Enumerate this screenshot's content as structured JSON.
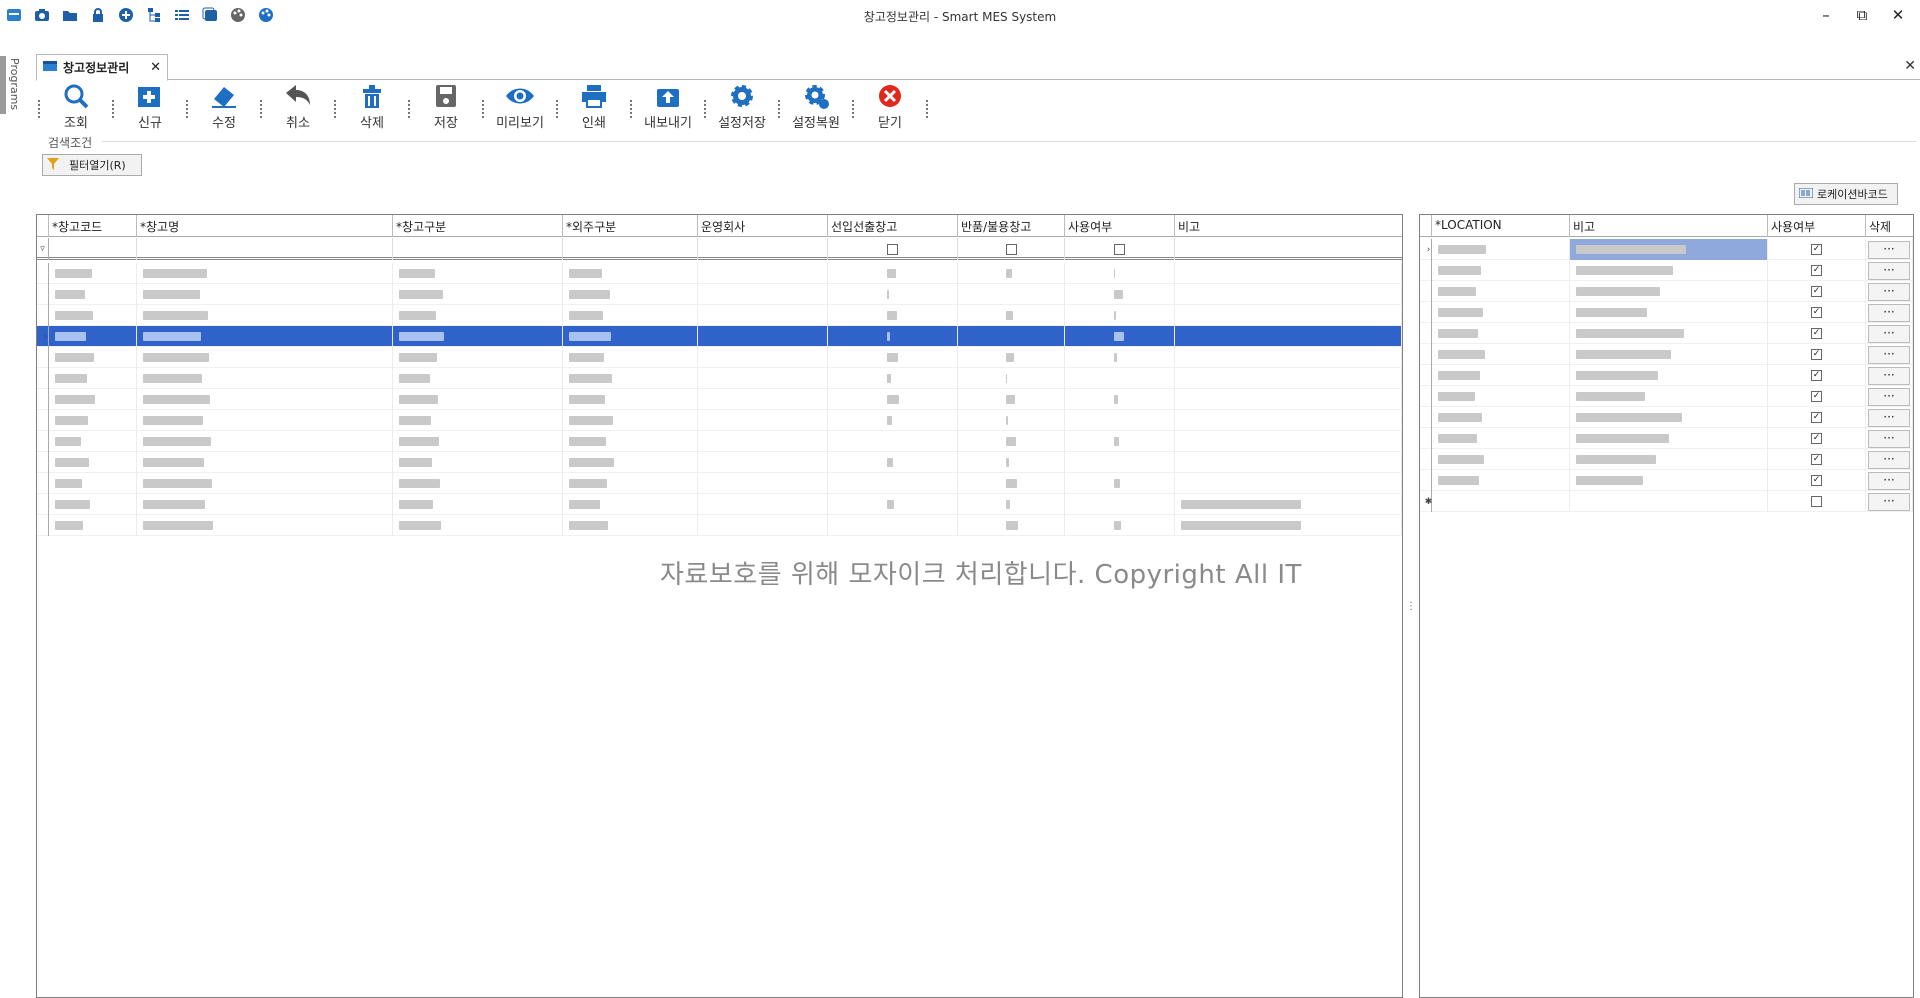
{
  "window": {
    "title": "창고정보관리 - Smart MES System",
    "quick_icons": [
      "app-icon",
      "camera-icon",
      "folder-icon",
      "lock-icon",
      "plus-circle-icon",
      "tree-icon",
      "list-icon",
      "window-icon",
      "palette-icon",
      "palette2-icon"
    ],
    "minimize": "–",
    "restore": "⧉",
    "close": "✕"
  },
  "side": {
    "programs_label": "Programs"
  },
  "tab": {
    "label": "창고정보관리",
    "close": "✕"
  },
  "doc_close": "✕",
  "toolbar": {
    "items": [
      {
        "label": "조회",
        "icon": "search-icon"
      },
      {
        "label": "신규",
        "icon": "new-icon"
      },
      {
        "label": "수정",
        "icon": "eraser-icon"
      },
      {
        "label": "취소",
        "icon": "undo-icon"
      },
      {
        "label": "삭제",
        "icon": "trash-icon"
      },
      {
        "label": "저장",
        "icon": "save-icon"
      },
      {
        "label": "미리보기",
        "icon": "eye-icon"
      },
      {
        "label": "인쇄",
        "icon": "print-icon"
      },
      {
        "label": "내보내기",
        "icon": "export-icon"
      },
      {
        "label": "설정저장",
        "icon": "gear-icon"
      },
      {
        "label": "설정복원",
        "icon": "gear-restore-icon"
      },
      {
        "label": "닫기",
        "icon": "close-circle-icon"
      }
    ]
  },
  "search": {
    "label": "검색조건",
    "filter_button": "필터열기(R)"
  },
  "barcode_button": "로케이션바코드",
  "left_grid": {
    "columns": [
      "*창고코드",
      "*창고명",
      "*창고구분",
      "*외주구분",
      "운영회사",
      "선입선출창고",
      "반품/불용창고",
      "사용여부",
      "비고"
    ]
  },
  "right_grid": {
    "columns": [
      "*LOCATION",
      "비고",
      "사용여부",
      "삭제"
    ],
    "delete_button": "···"
  },
  "watermark": "자료보호를 위해 모자이크 처리합니다. Copyright All IT",
  "colors": {
    "selection": "#2f63c9",
    "accent": "#1e6fc2",
    "close_red": "#e0281c"
  }
}
